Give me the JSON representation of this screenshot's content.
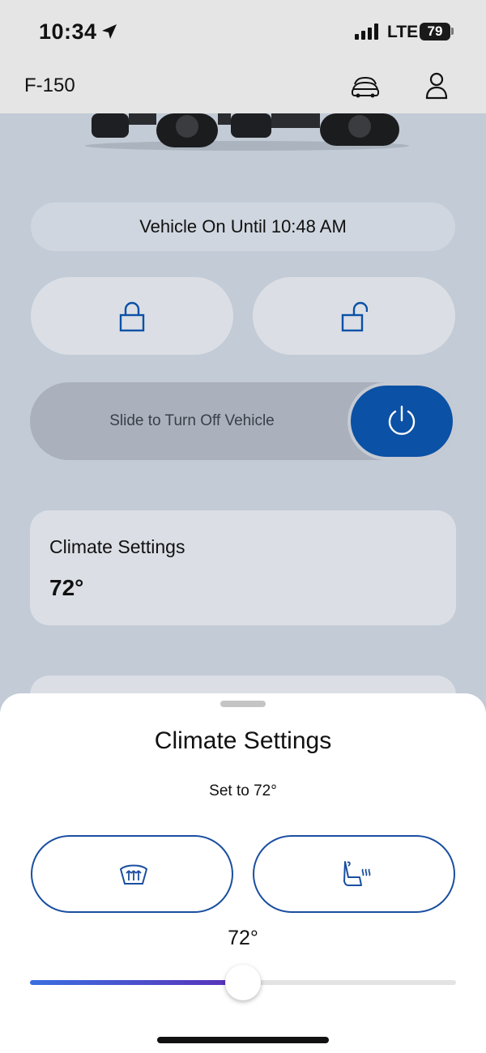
{
  "status_bar": {
    "time": "10:34",
    "network": "LTE",
    "battery": "79",
    "icons": [
      "location-arrow-icon",
      "cellular-signal-icon",
      "battery-icon"
    ]
  },
  "header": {
    "vehicle_name": "F-150",
    "icons": [
      "car-switch-icon",
      "profile-icon"
    ]
  },
  "vehicle_status": "Vehicle On Until 10:48 AM",
  "controls": {
    "lock_icon": "lock-icon",
    "unlock_icon": "unlock-icon",
    "slide_label": "Slide to Turn Off Vehicle",
    "power_icon": "power-icon"
  },
  "climate_card": {
    "title": "Climate Settings",
    "temperature": "72°"
  },
  "climate_sheet": {
    "title": "Climate Settings",
    "subtitle": "Set to 72°",
    "buttons": [
      "defrost-icon",
      "heated-seat-icon"
    ],
    "temperature": "72°",
    "slider_fraction": 0.5
  },
  "colors": {
    "accent": "#0b51a5",
    "page_background": "#c2cbd6",
    "header_background": "#e5e5e5",
    "slider_gradient_start": "#3a6fe0",
    "slider_gradient_end": "#5b2fb8"
  }
}
